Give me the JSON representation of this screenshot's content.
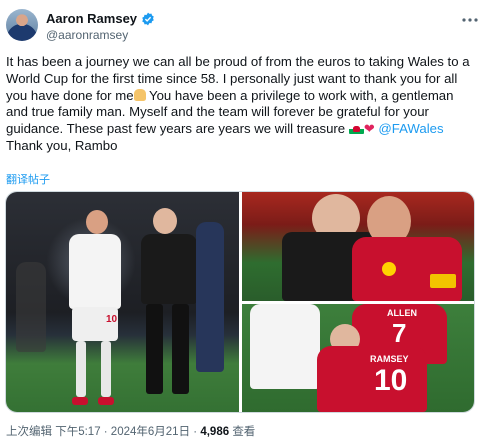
{
  "author": {
    "display_name": "Aaron Ramsey",
    "handle": "@aaronramsey",
    "verified": true
  },
  "tweet": {
    "text_part1": "It has been a journey we can all be proud of from the euros to taking Wales to a World Cup for the first time since 58. I personally just want to thank you for all you have done for me",
    "text_part2": " You have been a privilege to work with, a gentleman and true family man. Myself and the team will forever be grateful for your guidance. These past few years are years we will treasure ",
    "mention": "@FAWales",
    "sign_off": "Thank you, Rambo",
    "translate_label": "翻译帖子"
  },
  "photos": {
    "bottom_right": {
      "shirt_name_1": "ALLEN",
      "shirt_number_1": "7",
      "shirt_name_2": "RAMSEY",
      "shirt_number_2": "10"
    },
    "main": {
      "shirt_number": "10"
    }
  },
  "footer": {
    "edited_label": "上次编辑",
    "timestamp": "下午5:17 · 2024年6月21日",
    "separator": "·",
    "view_count": "4,986",
    "views_label": "查看"
  },
  "colors": {
    "link": "#1d9bf0",
    "verified": "#1d9bf0",
    "wales_red": "#c8102e",
    "text_primary": "#0f1419",
    "text_secondary": "#536471"
  },
  "icons": {
    "verified": "verified-badge-icon",
    "more": "more-options-icon",
    "flag": "wales-flag-icon",
    "heart": "red-heart-icon",
    "pray": "folded-hands-icon"
  }
}
